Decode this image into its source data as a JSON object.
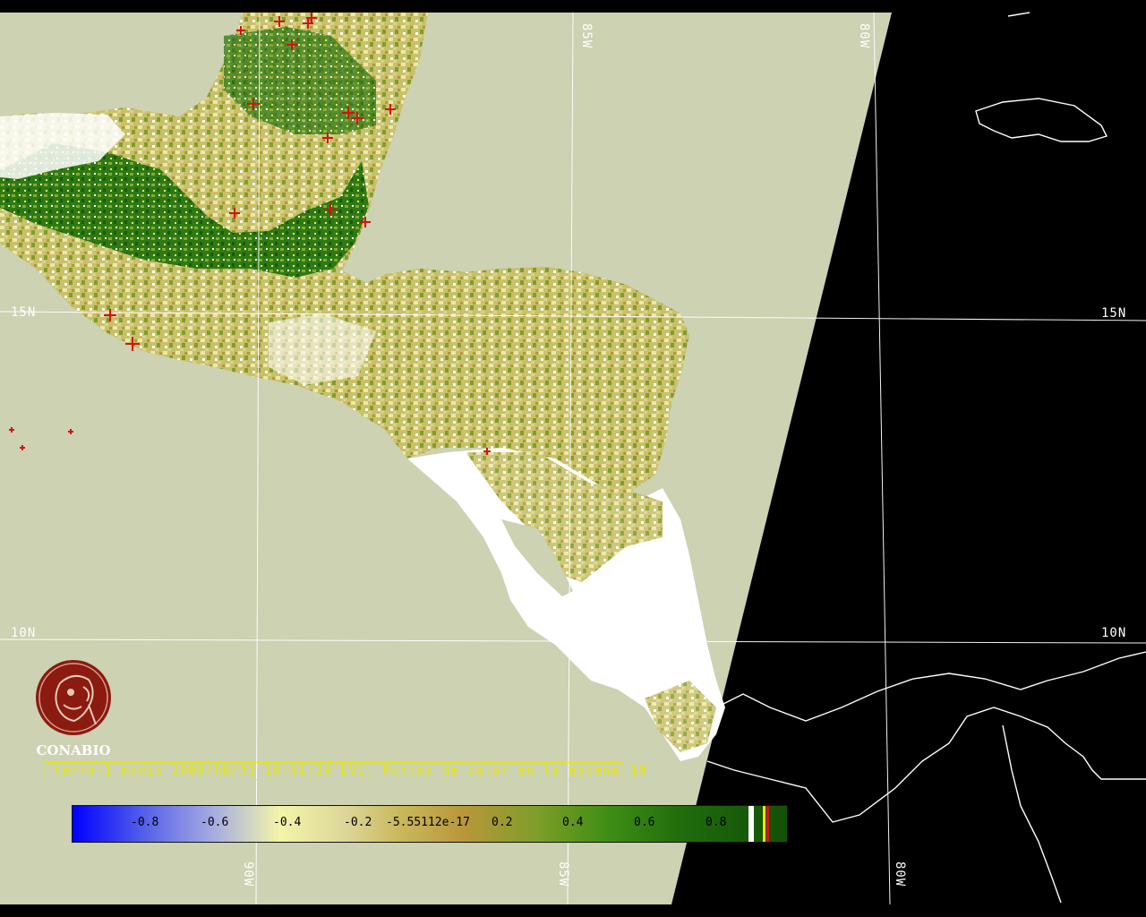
{
  "caption": {
    "text": "terra-1 modis 2008/08/31 16:41:29 EVI, Puntos de calor en la escena",
    "hotspot_count": "19",
    "color": "#e8e800"
  },
  "logo": {
    "name": "CONABIO",
    "color": "#8b1a10",
    "icon": "conabio-macaw-seal"
  },
  "grid": {
    "lat_labels": [
      "15N",
      "10N"
    ],
    "lon_labels_top": [
      "85W",
      "80W"
    ],
    "lon_labels_bottom": [
      "90W",
      "85W",
      "80W"
    ],
    "color": "#ffffff"
  },
  "colorbar": {
    "ticks": [
      "-0.8",
      "-0.6",
      "-0.4",
      "-0.2",
      "-5.55112e-17",
      "0.2",
      "0.4",
      "0.6",
      "0.8"
    ],
    "min_color": "#0000ff",
    "max_color": "#145008"
  },
  "colors": {
    "ocean_swath": "#ccd2b2",
    "outside_swath": "#000000",
    "coastline": "#ffffff",
    "hotspot": "#d21414",
    "cloud": "#ffffff",
    "vegetation_dense": "#1e6a0c"
  }
}
